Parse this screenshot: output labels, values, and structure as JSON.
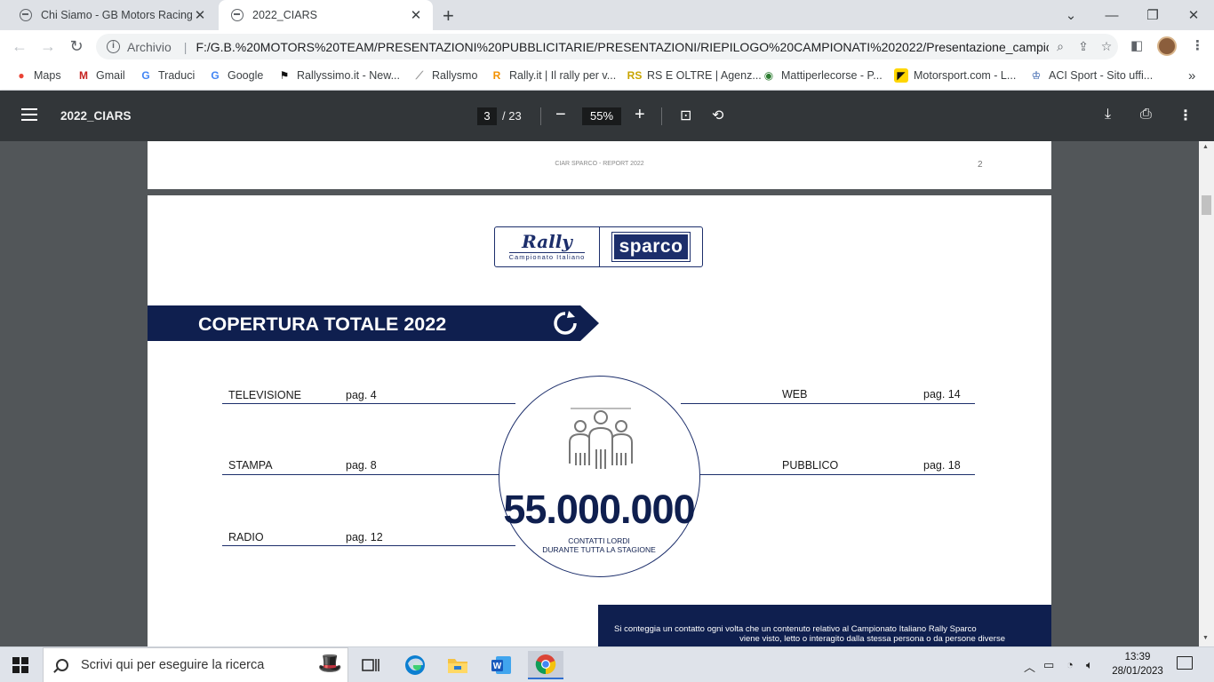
{
  "browser": {
    "tabs": [
      {
        "title": "Chi Siamo - GB Motors Racing",
        "active": false
      },
      {
        "title": "2022_CIARS",
        "active": true
      }
    ],
    "address": {
      "scheme_label": "Archivio",
      "url": "F:/G.B.%20MOTORS%20TEAM/PRESENTAZIONI%20PUBBLICITARIE/PRESENTAZIONI/RIEPILOGO%20CAMPIONATI%202022/Presentazione_campionato_2..."
    },
    "bookmarks": [
      {
        "label": "Maps",
        "icon": "maps-pin-icon",
        "color": "#ea4335"
      },
      {
        "label": "Gmail",
        "icon": "gmail-icon",
        "color": "#c5221f"
      },
      {
        "label": "Traduci",
        "icon": "translate-icon",
        "color": "#4285f4"
      },
      {
        "label": "Google",
        "icon": "google-icon",
        "color": "#4285f4"
      },
      {
        "label": "Rallyssimo.it - New...",
        "icon": "rallyssimo-icon",
        "color": "#111111"
      },
      {
        "label": "Rallysmo",
        "icon": "rallysmo-icon",
        "color": "#999999"
      },
      {
        "label": "Rally.it | Il rally per v...",
        "icon": "rally-it-icon",
        "color": "#f29100"
      },
      {
        "label": "RS E OLTRE | Agenz...",
        "icon": "rs-oltre-icon",
        "color": "#c8a400"
      },
      {
        "label": "Mattiperlecorse - P...",
        "icon": "mattiperlecorse-icon",
        "color": "#2e7d32"
      },
      {
        "label": "Motorsport.com - L...",
        "icon": "motorsport-icon",
        "color": "#111111"
      },
      {
        "label": "ACI Sport - Sito uffi...",
        "icon": "aci-sport-icon",
        "color": "#1c4da1"
      }
    ],
    "more_bookmarks": "»"
  },
  "pdf_toolbar": {
    "title": "2022_CIARS",
    "current_page": "3",
    "total_pages": "/ 23",
    "zoom": "55%"
  },
  "prev_page": {
    "header": "CIAR SPARCO - REPORT 2022",
    "page_number": "2"
  },
  "slide": {
    "logo_rally": "Rally",
    "logo_rally_sub": "Campionato Italiano",
    "logo_sparco": "sparco",
    "banner_title": "COPERTURA TOTALE 2022",
    "items_left": [
      {
        "label": "TELEVISIONE",
        "page": "pag. 4"
      },
      {
        "label": "STAMPA",
        "page": "pag. 8"
      },
      {
        "label": "RADIO",
        "page": "pag. 12"
      }
    ],
    "items_right": [
      {
        "label": "WEB",
        "page": "pag. 14"
      },
      {
        "label": "PUBBLICO",
        "page": "pag. 18"
      }
    ],
    "total_value": "55.000.000",
    "total_label_1": "CONTATTI LORDI",
    "total_label_2": "DURANTE TUTTA LA STAGIONE",
    "note_line_1": "Si conteggia un contatto ogni volta che un contenuto relativo al Campionato Italiano Rally Sparco",
    "note_line_2": "viene visto, letto o interagito dalla stessa persona o da persone diverse",
    "accent_color": "#0f1f4f"
  },
  "taskbar": {
    "search_placeholder": "Scrivi qui per eseguire la ricerca",
    "time": "13:39",
    "date": "28/01/2023"
  }
}
